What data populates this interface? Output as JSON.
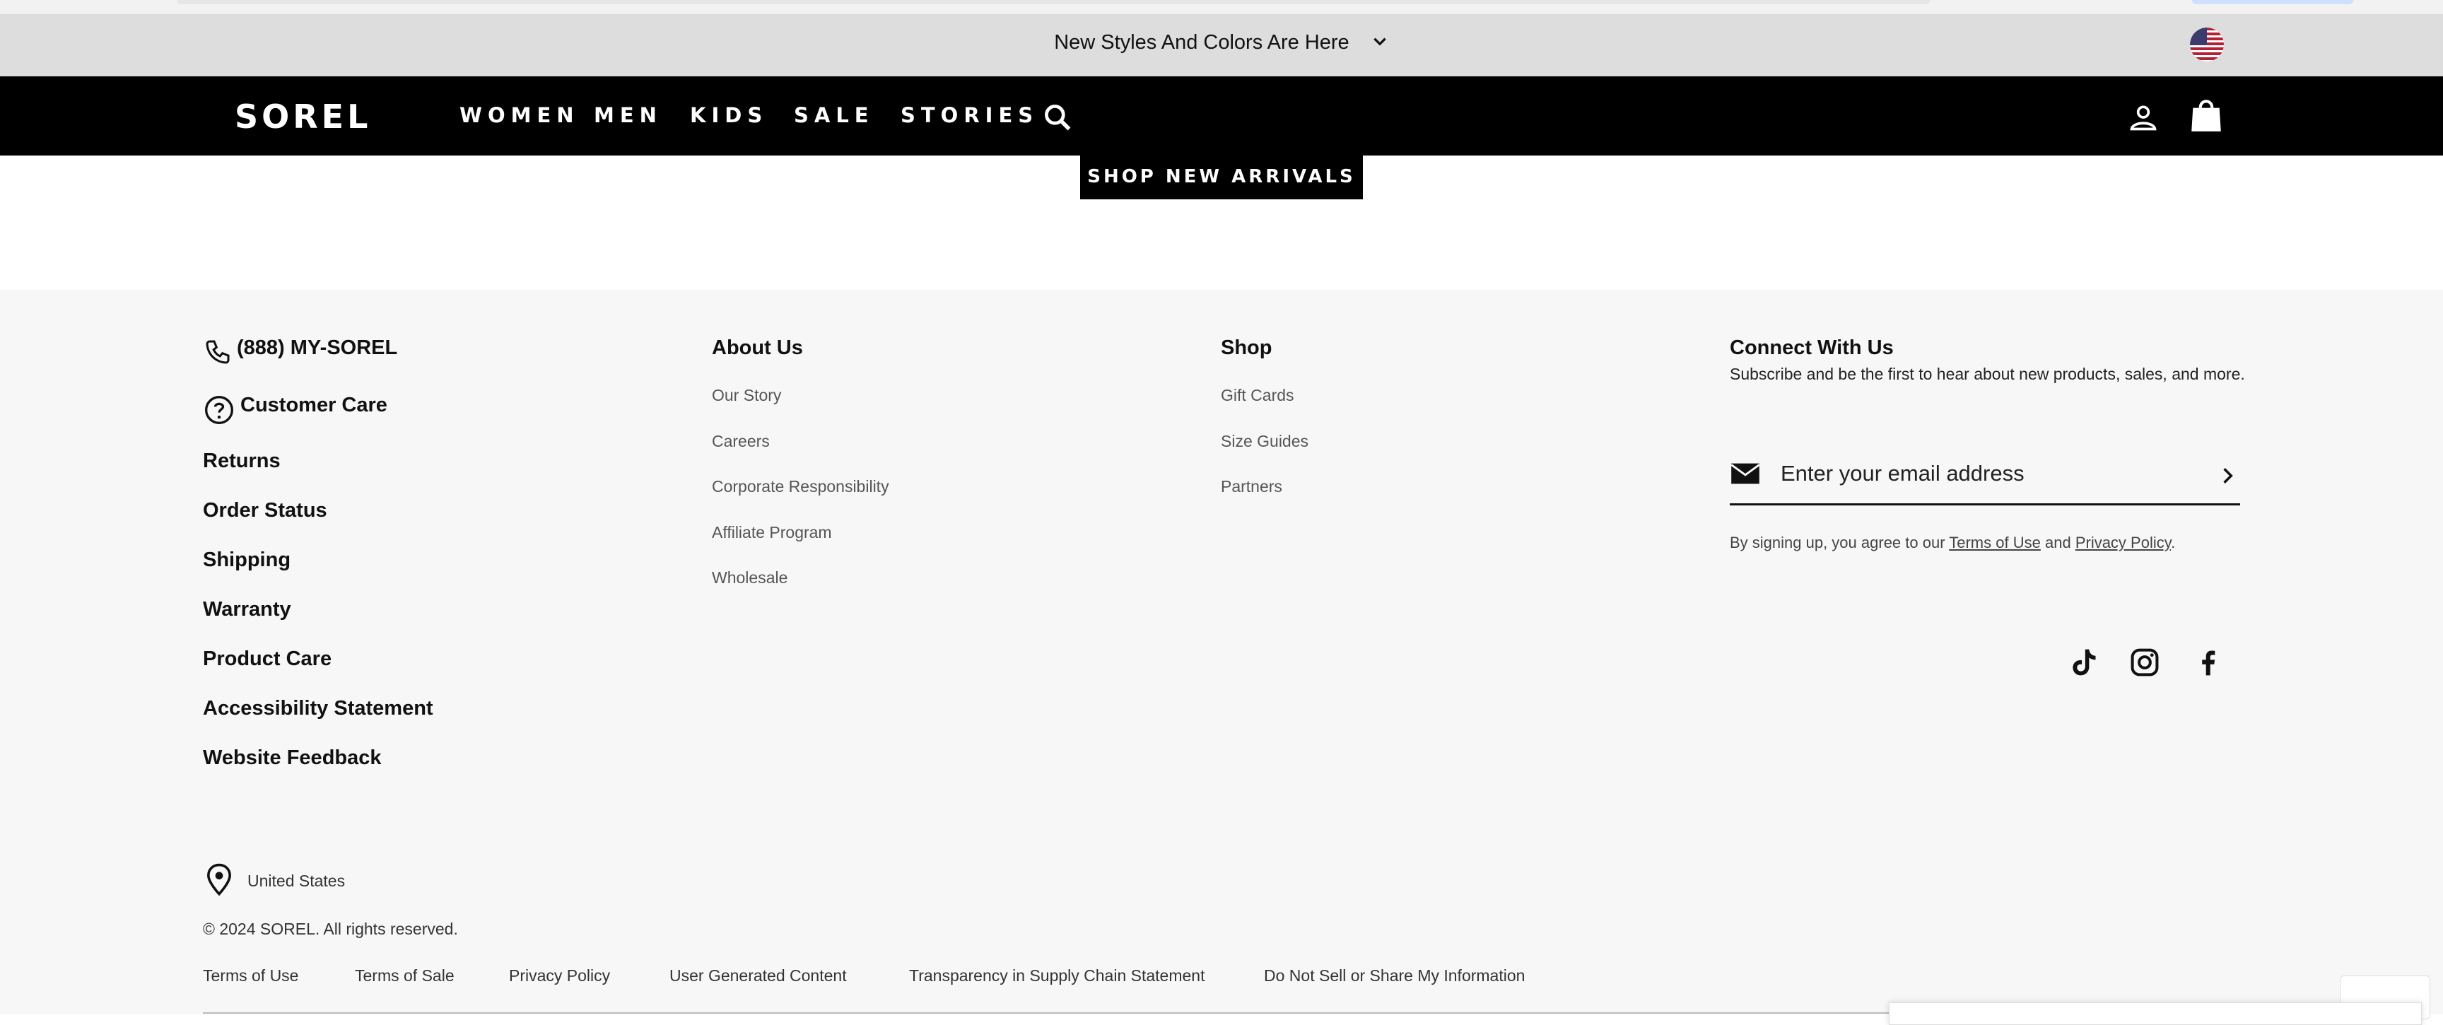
{
  "announcement": {
    "text": "New Styles And Colors Are Here"
  },
  "brand": {
    "logo": "SOREL"
  },
  "nav": {
    "items": [
      "WOMEN",
      "MEN",
      "KIDS",
      "SALE",
      "STORIES"
    ],
    "icons": [
      "search-icon",
      "account-icon",
      "bag-icon"
    ]
  },
  "cta": {
    "label": "SHOP NEW ARRIVALS"
  },
  "footer": {
    "phone": "(888) MY-SOREL",
    "customer_care": "Customer Care",
    "care_links": [
      "Returns",
      "Order Status",
      "Shipping",
      "Warranty",
      "Product Care",
      "Accessibility Statement",
      "Website Feedback"
    ],
    "about": {
      "title": "About Us",
      "links": [
        "Our Story",
        "Careers",
        "Corporate Responsibility",
        "Affiliate Program",
        "Wholesale"
      ]
    },
    "shop": {
      "title": "Shop",
      "links": [
        "Gift Cards",
        "Size Guides",
        "Partners"
      ]
    },
    "connect": {
      "title": "Connect With Us",
      "description": "Subscribe and be the first to hear about new products, sales, and more.",
      "email_placeholder": "Enter your email address",
      "legal_prefix": "By signing up, you agree to our",
      "terms": "Terms of Use",
      "and": "and",
      "privacy": "Privacy Policy",
      "period": "."
    },
    "social_icons": [
      "tiktok-icon",
      "instagram-icon",
      "facebook-icon"
    ],
    "location": "United States",
    "copyright": "© 2024 SOREL. All rights reserved.",
    "bottom_links": [
      "Terms of Use",
      "Terms of Sale",
      "Privacy Policy",
      "User Generated Content",
      "Transparency in Supply Chain Statement",
      "Do Not Sell or Share My Information"
    ]
  },
  "colors": {
    "nav_bg": "#000000",
    "announcement_bg": "#dddddd",
    "footer_bg": "#f7f7f8"
  }
}
